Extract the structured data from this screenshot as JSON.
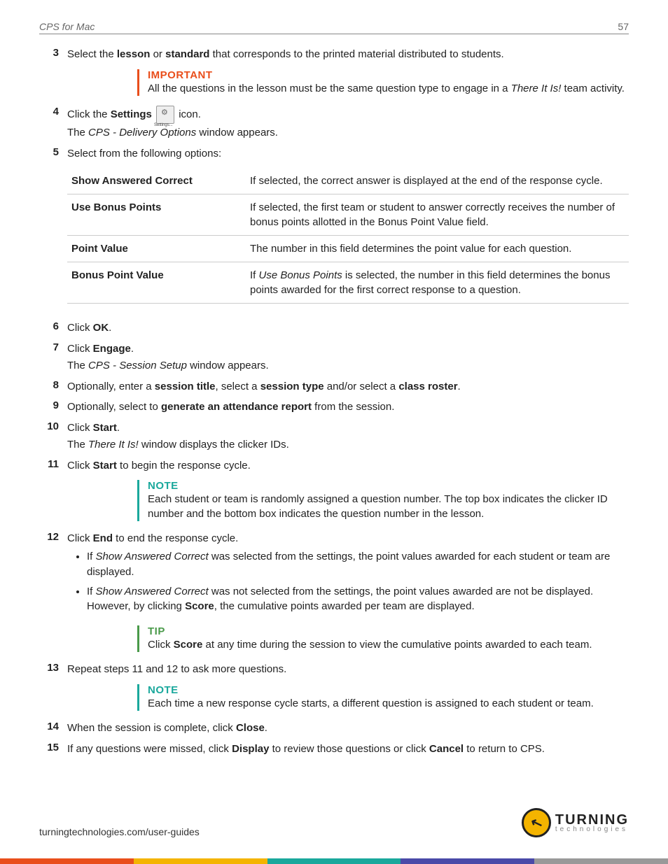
{
  "header": {
    "title": "CPS for Mac",
    "page": "57"
  },
  "steps": {
    "s3": {
      "num": "3",
      "pre": "Select the ",
      "b1": "lesson",
      "mid1": " or ",
      "b2": "standard",
      "post": " that corresponds to the printed material distributed to students."
    },
    "s4": {
      "num": "4",
      "pre": "Click the ",
      "b1": "Settings",
      "post": " icon.",
      "sub": "The ",
      "sub_i": "CPS - Delivery Options",
      "sub_post": " window appears."
    },
    "s5": {
      "num": "5",
      "text": "Select from the following options:"
    },
    "s6": {
      "num": "6",
      "pre": "Click ",
      "b1": "OK",
      "post": "."
    },
    "s7": {
      "num": "7",
      "pre": "Click ",
      "b1": "Engage",
      "post": ".",
      "sub": "The ",
      "sub_i": "CPS - Session Setup",
      "sub_post": " window appears."
    },
    "s8": {
      "num": "8",
      "pre": "Optionally, enter a ",
      "b1": "session title",
      "mid1": ", select a ",
      "b2": "session type",
      "mid2": " and/or select a ",
      "b3": "class roster",
      "post": "."
    },
    "s9": {
      "num": "9",
      "pre": "Optionally, select to ",
      "b1": "generate an attendance report",
      "post": " from the session."
    },
    "s10": {
      "num": "10",
      "pre": "Click ",
      "b1": "Start",
      "post": ".",
      "sub": "The ",
      "sub_i": "There It Is!",
      "sub_post": " window displays the clicker IDs."
    },
    "s11": {
      "num": "11",
      "pre": "Click ",
      "b1": "Start",
      "post": " to begin the response cycle."
    },
    "s12": {
      "num": "12",
      "pre": "Click ",
      "b1": "End",
      "post": " to end the response cycle."
    },
    "s13": {
      "num": "13",
      "text": "Repeat steps 11 and 12 to ask more questions."
    },
    "s14": {
      "num": "14",
      "pre": "When the session is complete, click ",
      "b1": "Close",
      "post": "."
    },
    "s15": {
      "num": "15",
      "pre": "If any questions were missed, click ",
      "b1": "Display",
      "mid1": " to review those questions or click ",
      "b2": "Cancel",
      "post": " to return to CPS."
    }
  },
  "callouts": {
    "important": {
      "title": "IMPORTANT",
      "pre": "All the questions in the lesson must be the same question type to engage in a ",
      "i1": "There It Is!",
      "post": " team activity."
    },
    "note1": {
      "title": "NOTE",
      "text": "Each student or team is randomly assigned a question number. The top box indicates the clicker ID number and the bottom box indicates the question number in the lesson."
    },
    "tip": {
      "title": "TIP",
      "pre": "Click ",
      "b1": "Score",
      "post": " at any time during the session to view the cumulative points awarded to each team."
    },
    "note2": {
      "title": "NOTE",
      "text": "Each time a new response cycle starts, a different question is assigned to each student or team."
    }
  },
  "table": {
    "r1": {
      "label": "Show Answered Correct",
      "desc": "If selected, the correct answer is displayed at the end of the response cycle."
    },
    "r2": {
      "label": "Use Bonus Points",
      "desc": "If selected, the first team or student to answer correctly receives the number of bonus points allotted in the Bonus Point Value field."
    },
    "r3": {
      "label": "Point Value",
      "desc": "The number in this field determines the point value for each question."
    },
    "r4": {
      "label": "Bonus Point Value",
      "pre": "If ",
      "i1": "Use Bonus Points",
      "post": " is selected, the number in this field determines the bonus points awarded for the first correct response to a question."
    }
  },
  "bullets": {
    "b1": {
      "pre": "If ",
      "i1": "Show Answered Correct",
      "post": " was selected from the settings, the point values awarded for each student or team are displayed."
    },
    "b2": {
      "pre": "If ",
      "i1": "Show Answered Correct",
      "mid": " was not selected from the settings, the point values awarded are not be displayed. However, by clicking ",
      "b1": "Score",
      "post": ", the cumulative points awarded per team are displayed."
    }
  },
  "footer": {
    "url": "turningtechnologies.com/user-guides",
    "logo1": "TURNING",
    "logo2": "technologies"
  }
}
